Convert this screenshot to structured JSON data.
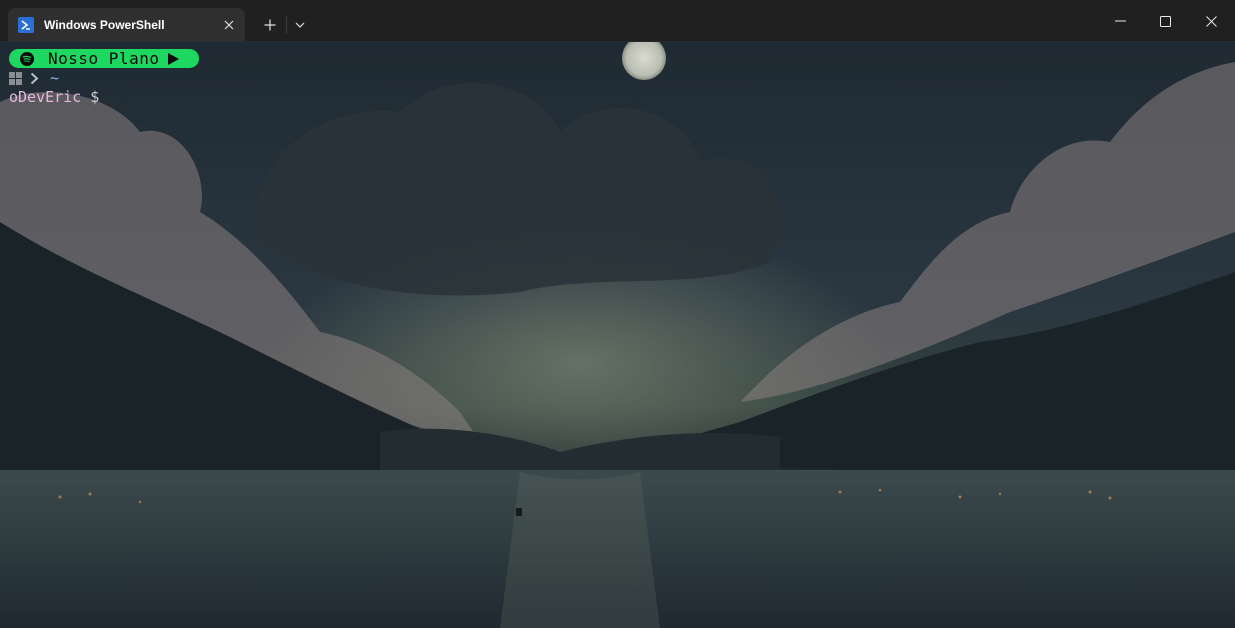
{
  "window": {
    "tab_title": "Windows PowerShell"
  },
  "prompt": {
    "spotify_track": "Nosso Plano",
    "path": "~",
    "user": "oDevEric",
    "symbol": "$"
  },
  "colors": {
    "spotify_green": "#1ed760",
    "user_color": "#e6b8dc",
    "path_color": "#8fb0e0",
    "titlebar": "#202020"
  },
  "icons": [
    "powershell-icon",
    "close-icon",
    "plus-icon",
    "chevron-down-icon",
    "minimize-icon",
    "maximize-icon",
    "spotify-icon",
    "play-icon",
    "windows-icon",
    "chevron-right-icon"
  ]
}
